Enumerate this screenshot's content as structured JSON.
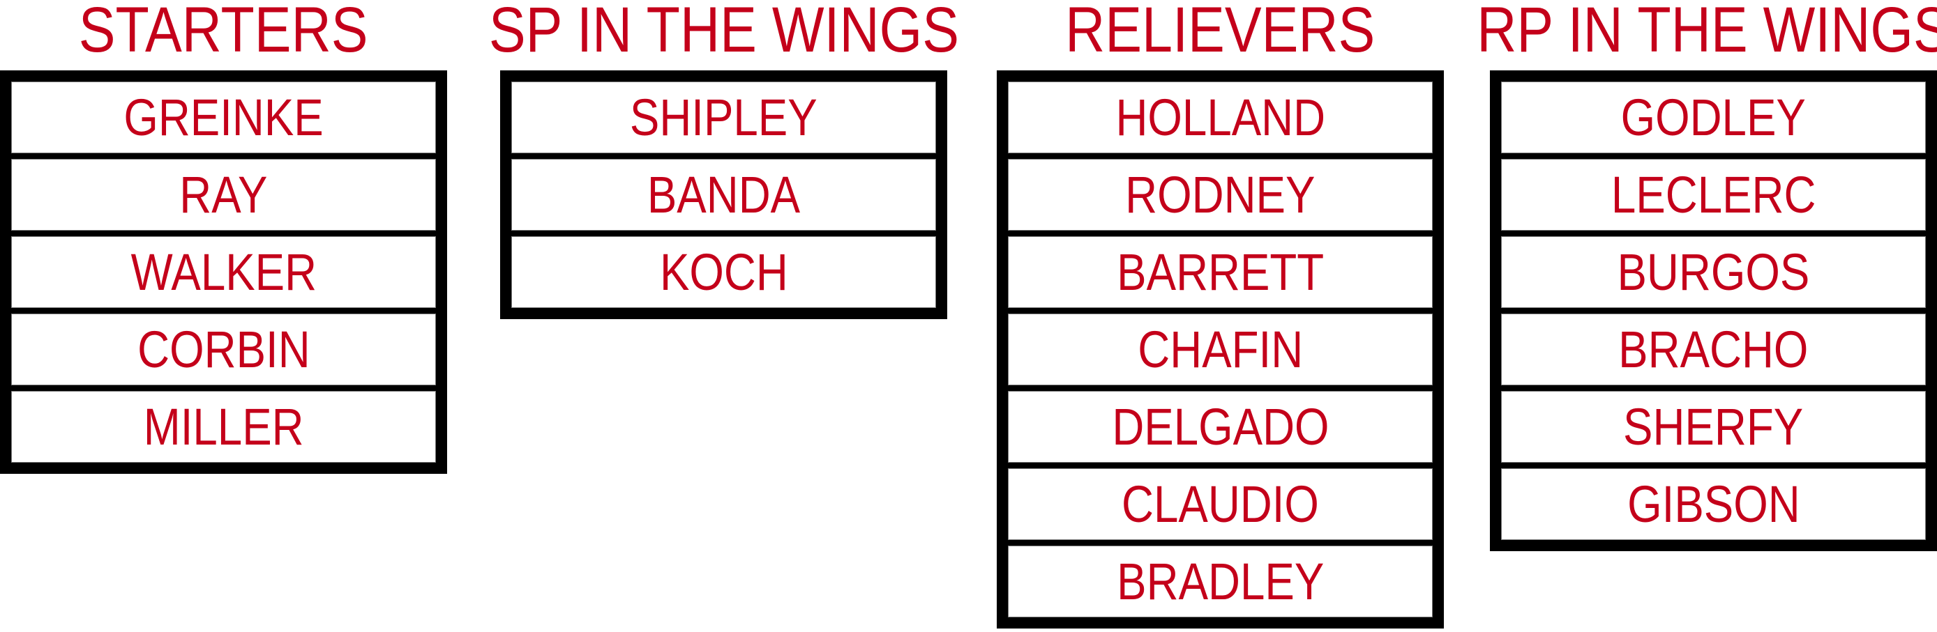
{
  "colors": {
    "text": "#c4001a",
    "border": "#000000"
  },
  "groups": [
    {
      "title": "STARTERS",
      "players": [
        "GREINKE",
        "RAY",
        "WALKER",
        "CORBIN",
        "MILLER"
      ]
    },
    {
      "title": "SP IN THE WINGS",
      "players": [
        "SHIPLEY",
        "BANDA",
        "KOCH"
      ]
    },
    {
      "title": "RELIEVERS",
      "players": [
        "HOLLAND",
        "RODNEY",
        "BARRETT",
        "CHAFIN",
        "DELGADO",
        "CLAUDIO",
        "BRADLEY"
      ]
    },
    {
      "title": "RP IN THE WINGS",
      "players": [
        "GODLEY",
        "LECLERC",
        "BURGOS",
        "BRACHO",
        "SHERFY",
        "GIBSON"
      ]
    }
  ]
}
